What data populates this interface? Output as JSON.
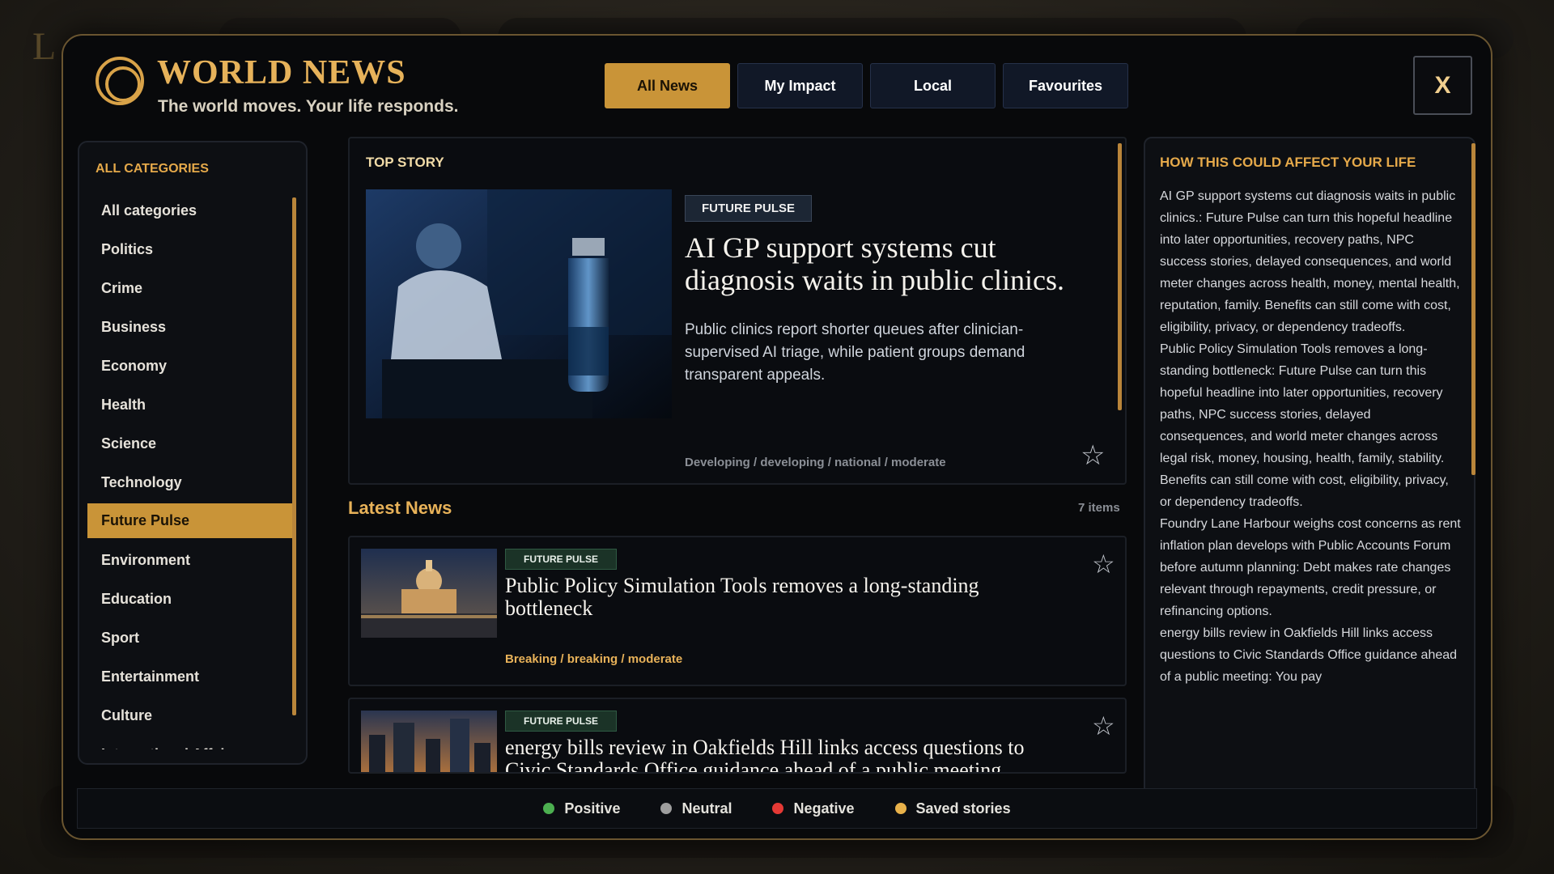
{
  "brand": {
    "title": "WORLD NEWS",
    "tagline": "The world moves. Your life responds."
  },
  "tabs": [
    {
      "label": "All News",
      "active": true
    },
    {
      "label": "My Impact",
      "active": false
    },
    {
      "label": "Local",
      "active": false
    },
    {
      "label": "Favourites",
      "active": false
    }
  ],
  "close_label": "X",
  "sidebar": {
    "heading": "ALL CATEGORIES",
    "items": [
      "All categories",
      "Politics",
      "Crime",
      "Business",
      "Economy",
      "Health",
      "Science",
      "Technology",
      "Future Pulse",
      "Environment",
      "Education",
      "Sport",
      "Entertainment",
      "Culture",
      "International Affairs"
    ],
    "active": "Future Pulse"
  },
  "top_story": {
    "label": "TOP STORY",
    "badge": "FUTURE PULSE",
    "title": "AI GP support systems cut diagnosis waits in public clinics.",
    "description": "Public clinics report shorter queues after clinician-supervised AI triage, while patient groups demand transparent appeals.",
    "meta": "Developing / developing / national / moderate"
  },
  "latest": {
    "title": "Latest News",
    "count": "7 items",
    "items": [
      {
        "badge": "FUTURE PULSE",
        "title": "Public Policy Simulation Tools removes a long-standing bottleneck",
        "meta": "Breaking / breaking / moderate"
      },
      {
        "badge": "FUTURE PULSE",
        "title": "energy bills review in Oakfields Hill links access questions to Civic Standards Office guidance ahead of a public meeting",
        "meta": ""
      }
    ]
  },
  "impact": {
    "heading": "HOW THIS COULD AFFECT YOUR LIFE",
    "paragraphs": [
      "AI GP support systems cut diagnosis waits in public clinics.: Future Pulse can turn this hopeful headline into later opportunities, recovery paths, NPC success stories, delayed consequences, and world meter changes across health, money, mental health, reputation, family. Benefits can still come with cost, eligibility, privacy, or dependency tradeoffs.",
      "Public Policy Simulation Tools removes a long-standing bottleneck: Future Pulse can turn this hopeful headline into later opportunities, recovery paths, NPC success stories, delayed consequences, and world meter changes across legal risk, money, housing, health, family, stability. Benefits can still come with cost, eligibility, privacy, or dependency tradeoffs.",
      "Foundry Lane Harbour weighs cost concerns as rent inflation plan develops with Public Accounts Forum before autumn planning: Debt makes rate changes relevant through repayments, credit pressure, or refinancing options.",
      "energy bills review in Oakfields Hill links access questions to Civic Standards Office guidance ahead of a public meeting: You pay"
    ]
  },
  "legend": [
    {
      "label": "Positive",
      "color": "#4caf50"
    },
    {
      "label": "Neutral",
      "color": "#9e9e9e"
    },
    {
      "label": "Negative",
      "color": "#e53935"
    },
    {
      "label": "Saved stories",
      "color": "#e8b14a"
    }
  ]
}
